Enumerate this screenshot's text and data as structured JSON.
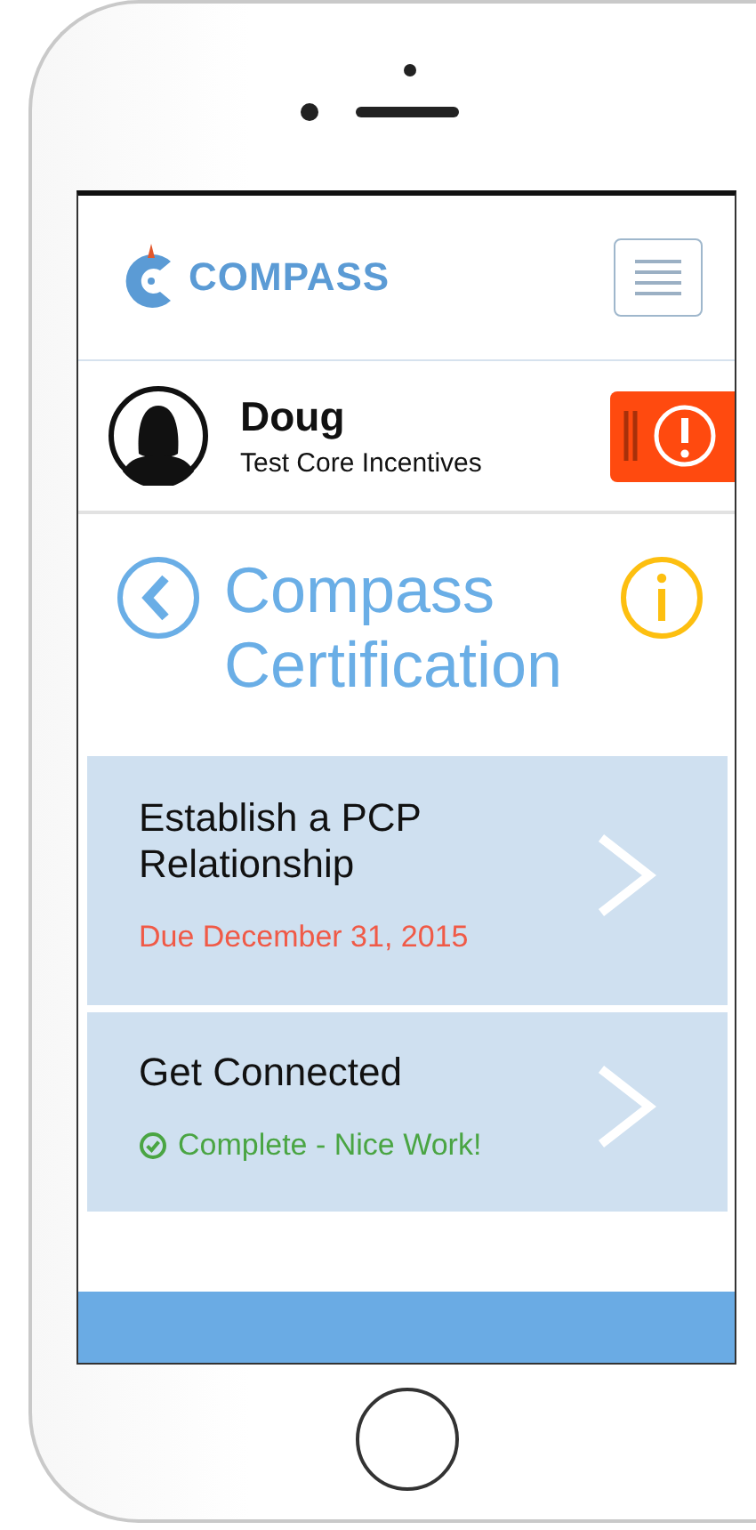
{
  "header": {
    "logo_text": "COMPASS"
  },
  "user": {
    "name": "Doug",
    "program": "Test Core Incentives"
  },
  "page": {
    "title": "Compass Certification"
  },
  "tasks": [
    {
      "title": "Establish a PCP Relationship",
      "status": "Due December 31, 2015",
      "kind": "due"
    },
    {
      "title": "Get Connected",
      "status": "Complete - Nice Work!",
      "kind": "complete"
    }
  ]
}
